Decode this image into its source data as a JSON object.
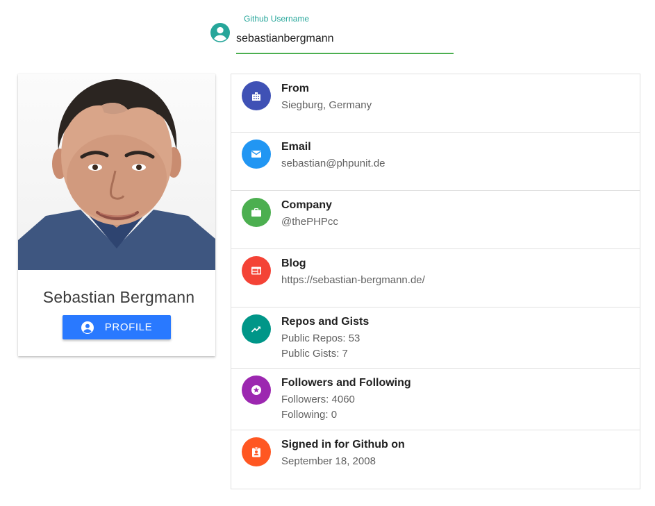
{
  "search": {
    "label": "Github Username",
    "value": "sebastianbergmann",
    "icon": "account-circle-icon",
    "accent_color": "#26a69a",
    "underline_color": "#4caf50"
  },
  "profile": {
    "name": "Sebastian Bergmann",
    "button_label": "PROFILE",
    "button_icon": "account-circle-icon",
    "button_color": "#2979ff"
  },
  "details": [
    {
      "title": "From",
      "line1": "Siegburg, Germany",
      "icon": "location-city-icon",
      "color": "#3f51b5"
    },
    {
      "title": "Email",
      "line1": "sebastian@phpunit.de",
      "icon": "mail-icon",
      "color": "#2196f3"
    },
    {
      "title": "Company",
      "line1": "@thePHPcc",
      "icon": "work-icon",
      "color": "#4caf50"
    },
    {
      "title": "Blog",
      "line1": "https://sebastian-bergmann.de/",
      "icon": "web-icon",
      "color": "#f44336"
    },
    {
      "title": "Repos and Gists",
      "line1": "Public Repos: 53",
      "line2": "Public Gists: 7",
      "icon": "trending-up-icon",
      "color": "#009688"
    },
    {
      "title": "Followers and Following",
      "line1": "Followers: 4060",
      "line2": "Following: 0",
      "icon": "stars-icon",
      "color": "#9c27b0"
    },
    {
      "title": "Signed in for Github on",
      "line1": "September 18, 2008",
      "icon": "assignment-ind-icon",
      "color": "#ff5722"
    }
  ]
}
